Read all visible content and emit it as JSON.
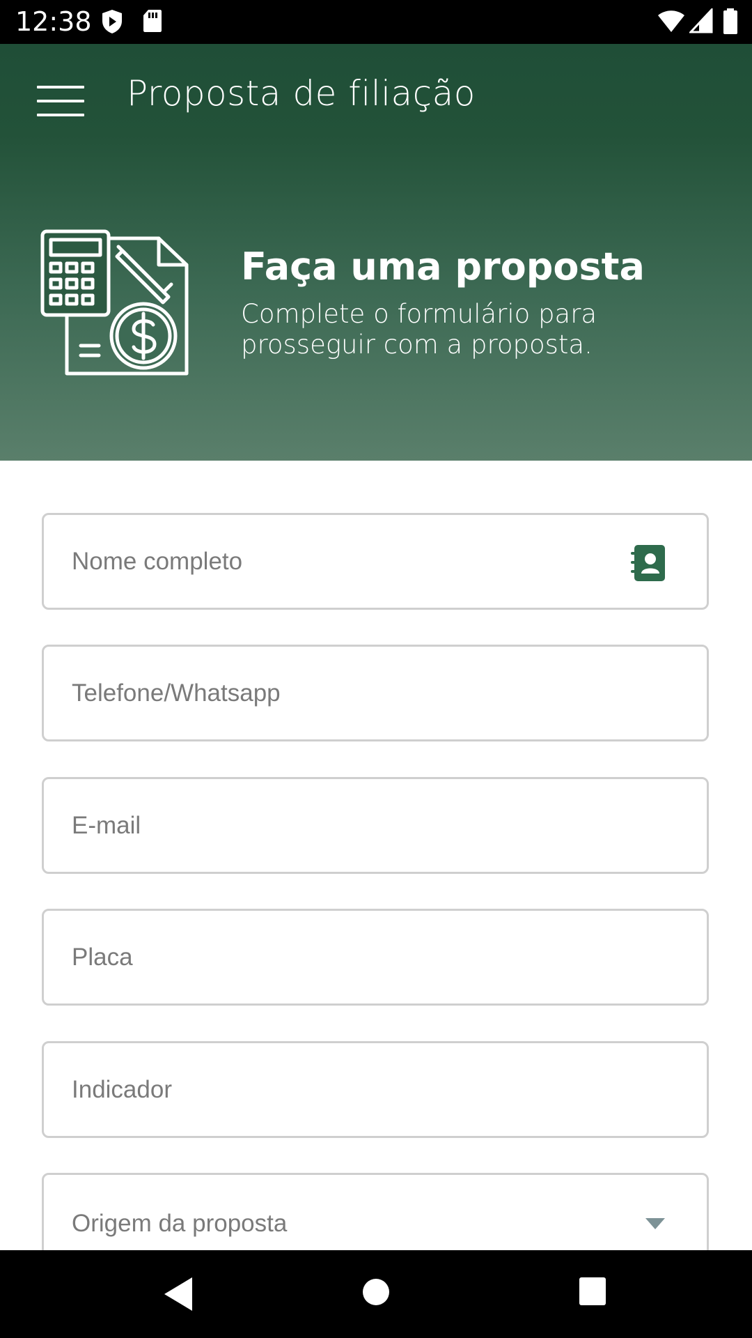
{
  "status_bar": {
    "time": "12:38"
  },
  "app_bar": {
    "title": "Proposta de filiação",
    "menu_icon": "menu-icon"
  },
  "hero": {
    "title": "Faça uma proposta",
    "subtitle": "Complete o formulário para prosseguir com a proposta.",
    "illustration_icon": "calculator-document-dollar-icon"
  },
  "form": {
    "full_name": {
      "placeholder": "Nome completo",
      "value": "",
      "trailing_icon": "contact-book-icon"
    },
    "phone": {
      "placeholder": "Telefone/Whatsapp",
      "value": ""
    },
    "email": {
      "placeholder": "E-mail",
      "value": ""
    },
    "plate": {
      "placeholder": "Placa",
      "value": ""
    },
    "referrer": {
      "placeholder": "Indicador",
      "value": ""
    },
    "origin": {
      "placeholder": "Origem da proposta",
      "trailing_icon": "dropdown-arrow-icon"
    }
  },
  "colors": {
    "brand_dark_green": "#1f4e37",
    "brand_light_green": "#5a7f6b",
    "accent_icon_green": "#2e6b4c",
    "field_border": "#cfcfcf",
    "placeholder_text": "#7a7a7a"
  }
}
